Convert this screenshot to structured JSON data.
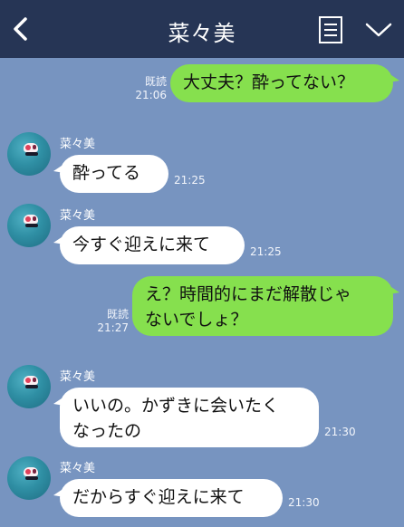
{
  "header": {
    "title": "菜々美",
    "back_icon": "chevron-left-icon",
    "menu_icon": "note-list-icon",
    "collapse_icon": "chevron-down-icon"
  },
  "colors": {
    "background": "#7794c0",
    "header": "#263555",
    "my_bubble": "#86e04e",
    "their_bubble": "#ffffff"
  },
  "messages": [
    {
      "from": "me",
      "text": "大丈夫？酔ってない？",
      "read": "既読",
      "time": "21:06"
    },
    {
      "from": "them",
      "sender": "菜々美",
      "text": "酔ってる",
      "time": "21:25"
    },
    {
      "from": "them",
      "sender": "菜々美",
      "text": "今すぐ迎えに来て",
      "time": "21:25"
    },
    {
      "from": "me",
      "lines": [
        "え？時間的にまだ解散じゃ",
        "ないでしょ？"
      ],
      "read": "既読",
      "time": "21:27"
    },
    {
      "from": "them",
      "sender": "菜々美",
      "lines": [
        "いいの。かずきに会いたく",
        "なったの"
      ],
      "time": "21:30"
    },
    {
      "from": "them",
      "sender": "菜々美",
      "text": "だからすぐ迎えに来て",
      "time": "21:30"
    }
  ]
}
